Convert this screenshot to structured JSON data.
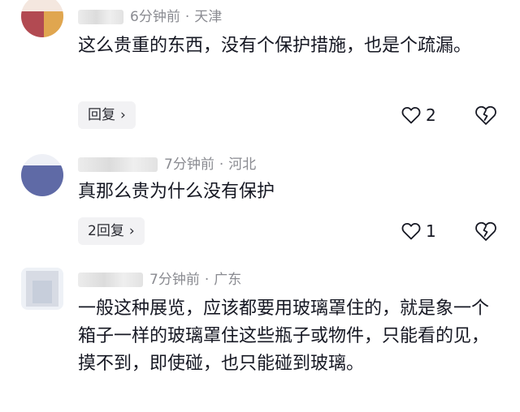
{
  "comments": [
    {
      "time": "6分钟前",
      "location": "天津",
      "text": "这么贵重的东西，没有个保护措施，也是个疏漏。",
      "reply_label": "回复",
      "like_count": "2",
      "avatar_colors": [
        "#b24a52",
        "#e0a64f"
      ]
    },
    {
      "time": "7分钟前",
      "location": "河北",
      "text": "真那么贵为什么没有保护",
      "reply_label": "2回复",
      "like_count": "1",
      "avatar_colors": [
        "#5f6aa6",
        "#6e79b3"
      ]
    },
    {
      "time": "7分钟前",
      "location": "广东",
      "text": "一般这种展览，应该都要用玻璃罩住的，就是象一个箱子一样的玻璃罩住这些瓶子或物件，只能看的见，摸不到，即使碰，也只能碰到玻璃。",
      "avatar_colors": [
        "#d7dbe4",
        "#c7cedb"
      ]
    }
  ],
  "separator": "·",
  "icons": {
    "reply_chevron": "chevron-right-icon",
    "like": "heart-outline-icon",
    "dislike": "broken-heart-icon"
  }
}
